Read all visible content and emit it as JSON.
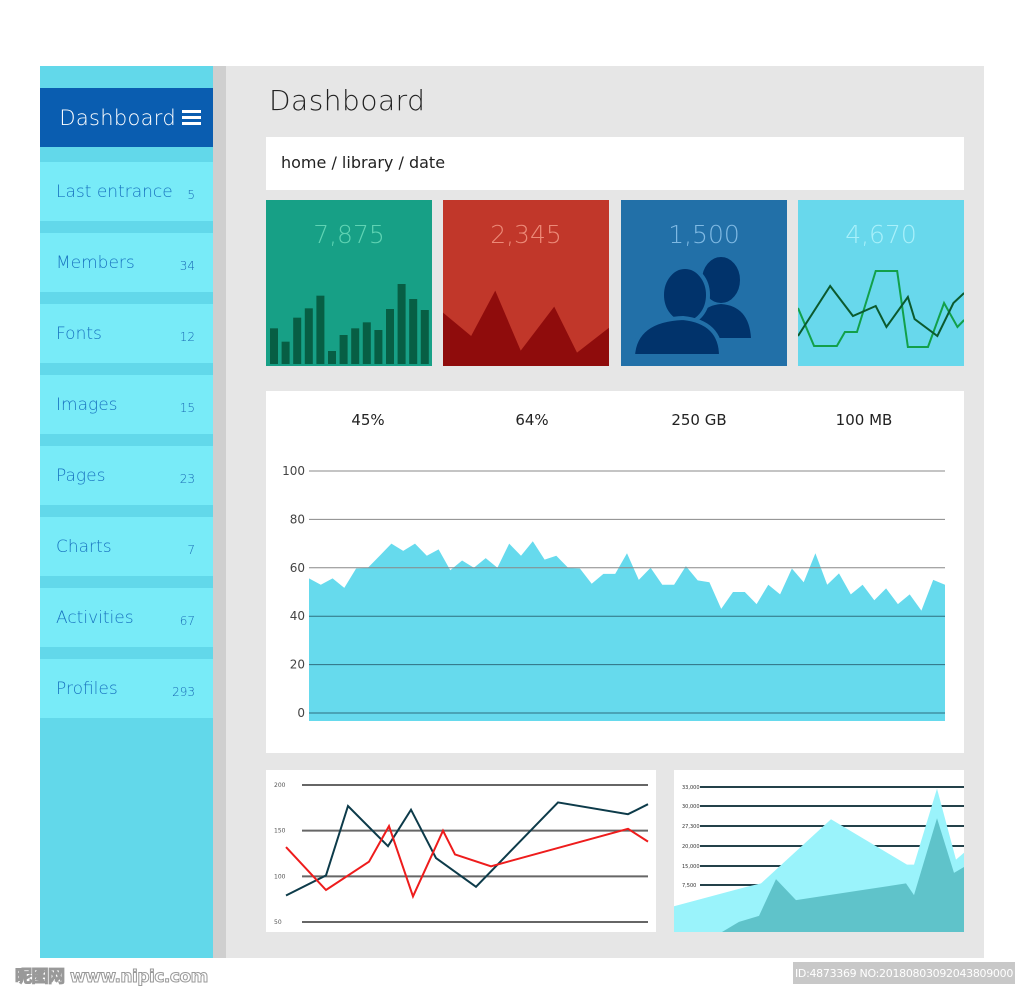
{
  "sidebar": {
    "title": "Dashboard",
    "menu_icon": "hamburger-menu-icon",
    "items": [
      {
        "label": "Last entrance",
        "count": "5"
      },
      {
        "label": "Members",
        "count": "34"
      },
      {
        "label": "Fonts",
        "count": "12"
      },
      {
        "label": "Images",
        "count": "15"
      },
      {
        "label": "Pages",
        "count": "23"
      },
      {
        "label": "Charts",
        "count": "7"
      },
      {
        "label": "Activities",
        "count": "67"
      },
      {
        "label": "Profiles",
        "count": "293"
      }
    ]
  },
  "header": {
    "title": "Dashboard",
    "breadcrumb": "home / library / date"
  },
  "cards": [
    {
      "value": "7,875",
      "color": "#17a086",
      "accent": "#075e44",
      "bars": [
        107,
        67,
        139,
        167,
        205,
        39,
        87,
        107,
        125,
        102,
        165,
        240,
        195,
        162
      ]
    },
    {
      "value": "2,345",
      "color": "#c1372a",
      "accent": "#8f0c0c",
      "area": [
        157,
        87,
        223,
        43,
        175,
        37,
        112
      ]
    },
    {
      "value": "1,500",
      "color": "#2270a8",
      "accent": "#01336b",
      "icon": "users-icon"
    },
    {
      "value": "4,670",
      "color": "#68d8ec",
      "accent": "#108a3a"
    }
  ],
  "stats": [
    "45%",
    "64%",
    "250 GB",
    "100 MB"
  ],
  "chart_data": [
    {
      "type": "area",
      "yticks": [
        "100",
        "80",
        "60",
        "40",
        "20",
        "0"
      ],
      "ylim": [
        0,
        100
      ],
      "grid": true,
      "color": "#66daed",
      "values": [
        55.6,
        53,
        55.6,
        51.7,
        59.7,
        60,
        65,
        70,
        67,
        70,
        65,
        67.6,
        59,
        63,
        60,
        64,
        60,
        70,
        65,
        71,
        63.4,
        65,
        60,
        59.7,
        53.4,
        57.5,
        57.5,
        66,
        55,
        60,
        53,
        53,
        60.7,
        54.8,
        54,
        43,
        50,
        50,
        45,
        53,
        49,
        59.7,
        54,
        66,
        53,
        57.7,
        49,
        53,
        46.6,
        51.5,
        45,
        49,
        42.3,
        55,
        53
      ]
    },
    {
      "type": "line",
      "yticks": [
        "200",
        "150",
        "100",
        "50"
      ],
      "ylim": [
        50,
        200
      ],
      "grid": true,
      "series": [
        {
          "color": "#0d3b4a",
          "values": [
            79,
            101,
            177,
            133,
            173,
            120,
            88.5,
            181,
            168,
            179
          ]
        },
        {
          "color": "#ee1c1c",
          "values": [
            132,
            85,
            116,
            155,
            78,
            150,
            124,
            111,
            152,
            138
          ]
        }
      ]
    },
    {
      "type": "area",
      "yticks": [
        "33,000",
        "30,000",
        "27,300",
        "20,000",
        "15,000",
        "7,500"
      ],
      "grid": true,
      "series": [
        {
          "color": "#9af3fb",
          "values": [
            4125,
            7232,
            8147,
            28200,
            15340,
            15340,
            32741,
            16610,
            18305
          ]
        },
        {
          "color": "#5fc3ca",
          "values": [
            0,
            1607,
            2571,
            9828,
            5089,
            8147,
            5893,
            28335,
            12284,
            14612
          ]
        }
      ]
    }
  ],
  "watermark": {
    "left": "昵图网 www.nipic.com",
    "right": "ID:4873369 NO:20180803092043809000"
  }
}
